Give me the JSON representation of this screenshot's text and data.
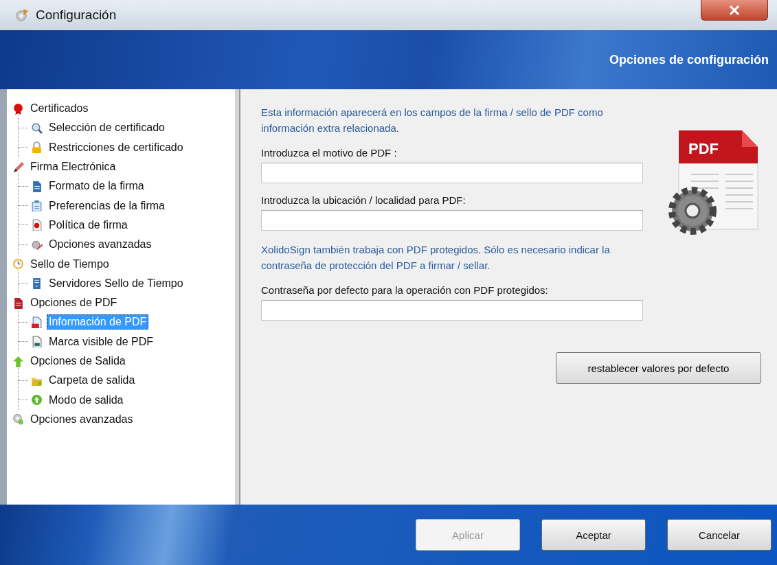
{
  "window": {
    "title": "Configuración"
  },
  "header": {
    "title": "Opciones de configuración"
  },
  "tree": [
    {
      "label": "Certificados",
      "selected": false,
      "children": [
        {
          "label": "Selección de certificado",
          "selected": false
        },
        {
          "label": "Restricciones de certificado",
          "selected": false
        }
      ]
    },
    {
      "label": "Firma Electrónica",
      "selected": false,
      "children": [
        {
          "label": "Formato de la firma",
          "selected": false
        },
        {
          "label": "Preferencias de la firma",
          "selected": false
        },
        {
          "label": "Política de firma",
          "selected": false
        },
        {
          "label": "Opciones avanzadas",
          "selected": false
        }
      ]
    },
    {
      "label": "Sello de Tiempo",
      "selected": false,
      "children": [
        {
          "label": "Servidores Sello de Tiempo",
          "selected": false
        }
      ]
    },
    {
      "label": "Opciones de PDF",
      "selected": false,
      "children": [
        {
          "label": "Información de PDF",
          "selected": true
        },
        {
          "label": "Marca visible de PDF",
          "selected": false
        }
      ]
    },
    {
      "label": "Opciones de Salida",
      "selected": false,
      "children": [
        {
          "label": "Carpeta de salida",
          "selected": false
        },
        {
          "label": "Modo de salida",
          "selected": false
        }
      ]
    },
    {
      "label": "Opciones avanzadas",
      "selected": false
    }
  ],
  "panel": {
    "sections": [
      {
        "note": "Esta información aparecerá en los campos de la firma / sello de PDF como información extra relacionada.",
        "fields": [
          {
            "label": "Introduzca el motivo de PDF :"
          },
          {
            "label": "Introduzca la ubicación / localidad para PDF:"
          }
        ]
      },
      {
        "note": "XolidoSign también trabaja con PDF protegidos. Sólo es necesario indicar la contraseña de protección del PDF a firmar / sellar.",
        "fields": [
          {
            "label": "Contraseña por defecto para la operación con PDF protegidos:"
          }
        ]
      }
    ],
    "art_label": "PDF",
    "reset_button": {
      "label": "restablecer valores por defecto"
    }
  },
  "buttons": [
    {
      "label": "Aplicar",
      "disabled": true
    },
    {
      "label": "Aceptar",
      "disabled": false
    },
    {
      "label": "Cancelar",
      "disabled": false
    }
  ]
}
